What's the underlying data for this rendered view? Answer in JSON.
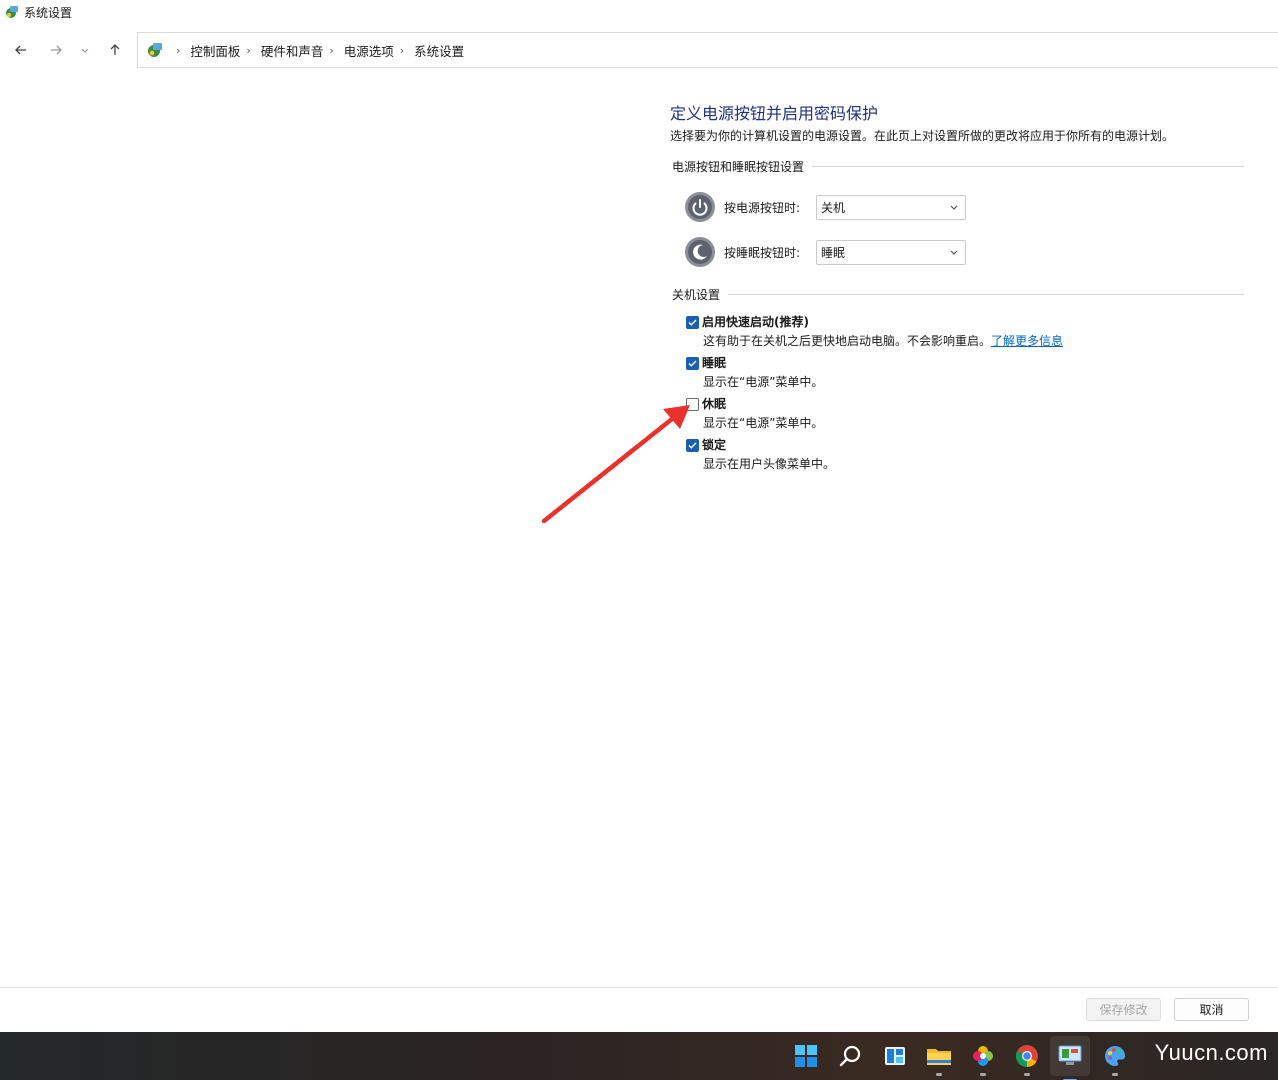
{
  "window": {
    "title": "系统设置"
  },
  "breadcrumb": [
    "控制面板",
    "硬件和声音",
    "电源选项",
    "系统设置"
  ],
  "nav": {
    "back_icon": "arrow-left-icon",
    "forward_icon": "arrow-right-icon",
    "recent_icon": "chevron-down-icon",
    "up_icon": "arrow-up-icon"
  },
  "main": {
    "title": "定义电源按钮并启用密码保护",
    "description": "选择要为你的计算机设置的电源设置。在此页上对设置所做的更改将应用于你所有的电源计划。",
    "power_section": {
      "heading": "电源按钮和睡眠按钮设置",
      "power_button": {
        "label": "按电源按钮时:",
        "value": "关机"
      },
      "sleep_button": {
        "label": "按睡眠按钮时:",
        "value": "睡眠"
      }
    },
    "shutdown_section": {
      "heading": "关机设置",
      "items": [
        {
          "label": "启用快速启动(推荐)",
          "desc": "这有助于在关机之后更快地启动电脑。不会影响重启。",
          "link": "了解更多信息",
          "checked": true
        },
        {
          "label": "睡眠",
          "desc": "显示在“电源”菜单中。",
          "checked": true
        },
        {
          "label": "休眠",
          "desc": "显示在“电源”菜单中。",
          "checked": false
        },
        {
          "label": "锁定",
          "desc": "显示在用户头像菜单中。",
          "checked": true
        }
      ]
    }
  },
  "footer": {
    "save": "保存修改",
    "cancel": "取消"
  },
  "taskbar": {
    "icons": [
      "windows-start-icon",
      "search-icon",
      "widgets-icon",
      "file-explorer-icon",
      "photos-icon",
      "chrome-icon",
      "control-panel-icon",
      "paint-icon"
    ],
    "watermark": "Yuucn.com"
  },
  "colors": {
    "accent": "#1a5fb4",
    "title_blue": "#1e3287",
    "annotation_arrow": "#e8322b"
  }
}
